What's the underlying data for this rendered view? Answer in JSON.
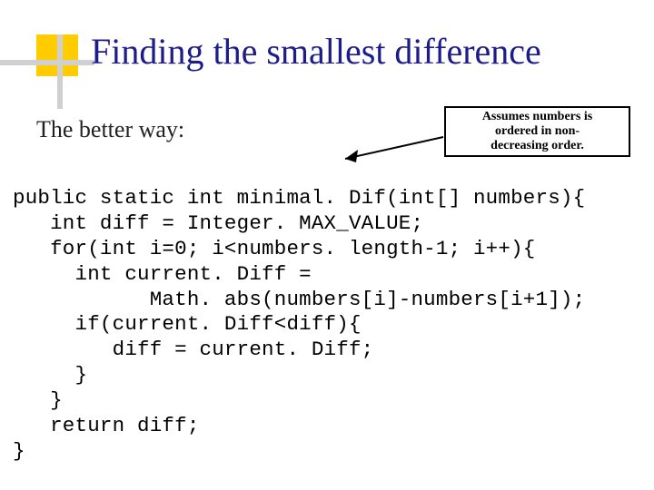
{
  "title": "Finding the smallest difference",
  "subhead": "The better way:",
  "note": {
    "l1": "Assumes numbers is",
    "l2": "ordered in non-",
    "l3": "decreasing order."
  },
  "code": {
    "l1": "public static int minimal. Dif(int[] numbers){",
    "l2": "   int diff = Integer. MAX_VALUE;",
    "l3": "   for(int i=0; i<numbers. length-1; i++){",
    "l4": "     int current. Diff =",
    "l5": "           Math. abs(numbers[i]-numbers[i+1]);",
    "l6": "     if(current. Diff<diff){",
    "l7": "        diff = current. Diff;",
    "l8": "     }",
    "l9": "   }",
    "l10": "   return diff;",
    "l11": "}"
  }
}
